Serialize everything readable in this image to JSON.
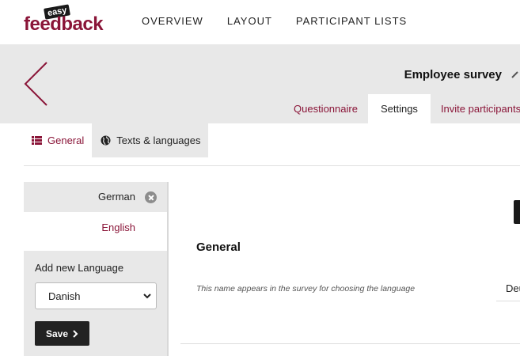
{
  "logo": {
    "small": "easy",
    "main": "feedback"
  },
  "nav": {
    "items": [
      "OVERVIEW",
      "LAYOUT",
      "PARTICIPANT LISTS"
    ]
  },
  "header": {
    "survey_title": "Employee survey",
    "tabs": [
      "Questionnaire",
      "Settings",
      "Invite participants"
    ],
    "active_tab": "Settings"
  },
  "subtabs": {
    "general": "General",
    "texts": "Texts & languages"
  },
  "languages": {
    "items": [
      "German",
      "English"
    ],
    "active": "English",
    "add_title": "Add new Language",
    "select_value": "Danish",
    "save_label": "Save"
  },
  "content": {
    "section_title": "General",
    "hint": "This name appears in the survey for choosing the language",
    "input_value": "Deutsch"
  },
  "colors": {
    "brand": "#8a1538",
    "panel": "#e8e8e8",
    "dark": "#222222"
  }
}
